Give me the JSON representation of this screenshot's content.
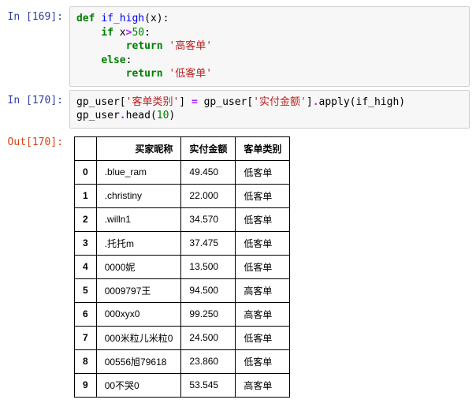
{
  "prompts": {
    "in169": "In  [169]:",
    "in170": "In  [170]:",
    "out170": "Out[170]:"
  },
  "code169": {
    "kw_def": "def",
    "fn_name": "if_high",
    "paren_open": "(",
    "arg_x": "x",
    "paren_close": ")",
    "colon1": ":",
    "kw_if": "if",
    "var_x": "x",
    "op_gt": ">",
    "num_50": "50",
    "colon2": ":",
    "kw_return1": "return",
    "str_high": "'高客单'",
    "kw_else": "else",
    "colon3": ":",
    "kw_return2": "return",
    "str_low": "'低客单'"
  },
  "code170": {
    "var1": "gp_user[",
    "str_cat": "'客单类别'",
    "mid1": "] ",
    "op_eq": "=",
    "mid2": " gp_user[",
    "str_amt": "'实付金额'",
    "mid3": "]",
    "dot_apply": ".",
    "fn_apply": "apply",
    "open": "(if_high)",
    "line2a": "gp_user",
    "dot_head": ".",
    "fn_head": "head",
    "open2": "(",
    "num_10": "10",
    "close2": ")"
  },
  "table": {
    "headers": {
      "name": "买家昵称",
      "amount": "实付金额",
      "category": "客单类别"
    },
    "rows": [
      {
        "idx": "0",
        "name": ".blue_ram",
        "amount": "49.450",
        "category": "低客单"
      },
      {
        "idx": "1",
        "name": ".christiny",
        "amount": "22.000",
        "category": "低客单"
      },
      {
        "idx": "2",
        "name": ".willn1",
        "amount": "34.570",
        "category": "低客单"
      },
      {
        "idx": "3",
        "name": ".托托m",
        "amount": "37.475",
        "category": "低客单"
      },
      {
        "idx": "4",
        "name": "0000妮",
        "amount": "13.500",
        "category": "低客单"
      },
      {
        "idx": "5",
        "name": "0009797王",
        "amount": "94.500",
        "category": "高客单"
      },
      {
        "idx": "6",
        "name": "000xyx0",
        "amount": "99.250",
        "category": "高客单"
      },
      {
        "idx": "7",
        "name": "000米粒儿米粒0",
        "amount": "24.500",
        "category": "低客单"
      },
      {
        "idx": "8",
        "name": "00556旭79618",
        "amount": "23.860",
        "category": "低客单"
      },
      {
        "idx": "9",
        "name": "00不哭0",
        "amount": "53.545",
        "category": "高客单"
      }
    ]
  }
}
